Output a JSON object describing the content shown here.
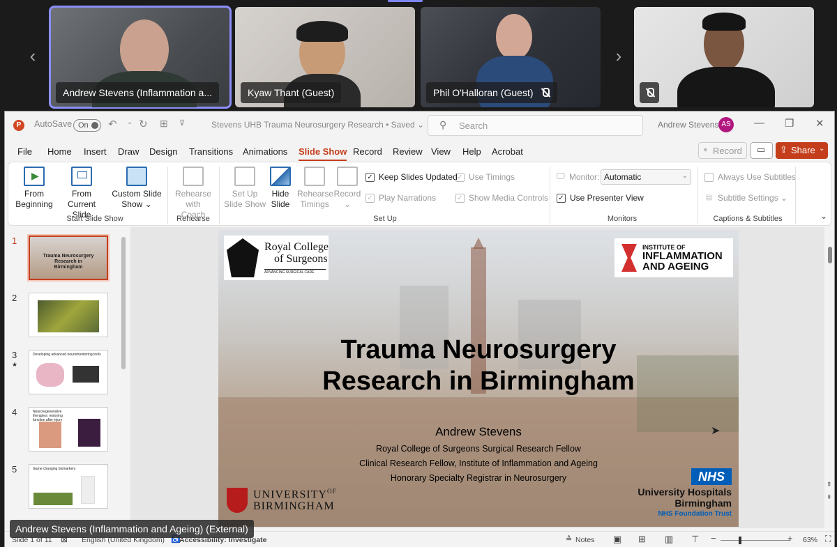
{
  "meeting": {
    "participants": [
      {
        "name": "Andrew Stevens (Inflammation a...",
        "muted": false,
        "selected": true
      },
      {
        "name": "Kyaw Thant (Guest)",
        "muted": false
      },
      {
        "name": "Phil O'Halloran (Guest)",
        "muted": true
      },
      {
        "name": "",
        "muted": true
      }
    ],
    "prev_arrow": "‹",
    "next_arrow": "›",
    "presenter_caption": "Andrew Stevens (Inflammation and Ageing) (External)"
  },
  "titlebar": {
    "logo": "P",
    "autosave_label": "AutoSave",
    "autosave_state": "On",
    "doc_title": "Stevens UHB Trauma Neurosurgery Research • Saved ⌄",
    "search_placeholder": "Search",
    "user_name": "Andrew Stevens",
    "user_initials": "AS"
  },
  "menu": {
    "tabs": [
      "File",
      "Home",
      "Insert",
      "Draw",
      "Design",
      "Transitions",
      "Animations",
      "Slide Show",
      "Record",
      "Review",
      "View",
      "Help",
      "Acrobat"
    ],
    "active": "Slide Show",
    "record_label": "Record",
    "share_label": "Share"
  },
  "ribbon": {
    "from_beginning": [
      "From",
      "Beginning"
    ],
    "from_current": [
      "From",
      "Current Slide"
    ],
    "custom_show": [
      "Custom Slide",
      "Show ⌄"
    ],
    "group_start": "Start Slide Show",
    "rehearse_coach": [
      "Rehearse",
      "with Coach"
    ],
    "group_rehearse": "Rehearse",
    "setup_show": [
      "Set Up",
      "Slide Show"
    ],
    "hide_slide": [
      "Hide",
      "Slide"
    ],
    "rehearse_timings": [
      "Rehearse",
      "Timings"
    ],
    "record": [
      "Record",
      "⌄"
    ],
    "keep_updated": "Keep Slides Updated",
    "play_narrations": "Play Narrations",
    "use_timings": "Use Timings",
    "show_media": "Show Media Controls",
    "group_setup": "Set Up",
    "monitor_label": "Monitor:",
    "monitor_value": "Automatic",
    "presenter_view": "Use Presenter View",
    "group_monitors": "Monitors",
    "always_subtitles": "Always Use Subtitles",
    "subtitle_settings": "Subtitle Settings ⌄",
    "group_captions": "Captions & Subtitles"
  },
  "thumbnails": [
    {
      "num": "1",
      "label": "Trauma Neurosurgery Research in Birmingham",
      "selected": true
    },
    {
      "num": "2",
      "label": ""
    },
    {
      "num": "3",
      "label": "Developing advanced neuromonitoring tools",
      "star": "★"
    },
    {
      "num": "4",
      "label": "Neuroregenerative therapies: restoring function after injury"
    },
    {
      "num": "5",
      "label": "Game changing biomarkers"
    }
  ],
  "slide": {
    "rcs_line1": "Royal College",
    "rcs_line2": "of Surgeons",
    "rcs_tag": "ADVANCING SURGICAL CARE",
    "iia_line1": "INSTITUTE OF",
    "iia_line2": "INFLAMMATION",
    "iia_line3": "AND AGEING",
    "title_line1": "Trauma Neurosurgery",
    "title_line2": "Research in Birmingham",
    "author": "Andrew Stevens",
    "role1": "Royal College of Surgeons Surgical Research Fellow",
    "role2": "Clinical Research Fellow, Institute of Inflammation and Ageing",
    "role3": "Honorary Specialty Registrar in Neurosurgery",
    "uob_line1": "UNIVERSITY",
    "uob_of": "OF",
    "uob_line2": "BIRMINGHAM",
    "nhs": "NHS",
    "uhb_line1": "University Hospitals",
    "uhb_line2": "Birmingham",
    "uhb_line3": "NHS Foundation Trust"
  },
  "status": {
    "slide_count": "Slide 1 of 11",
    "language": "English (United Kingdom)",
    "accessibility": "Accessibility: Investigate",
    "notes": "Notes",
    "zoom": "63%"
  },
  "colors": {
    "accent": "#c43e1c",
    "teams_highlight": "#8b8ff7",
    "nhs_blue": "#005eb8"
  }
}
